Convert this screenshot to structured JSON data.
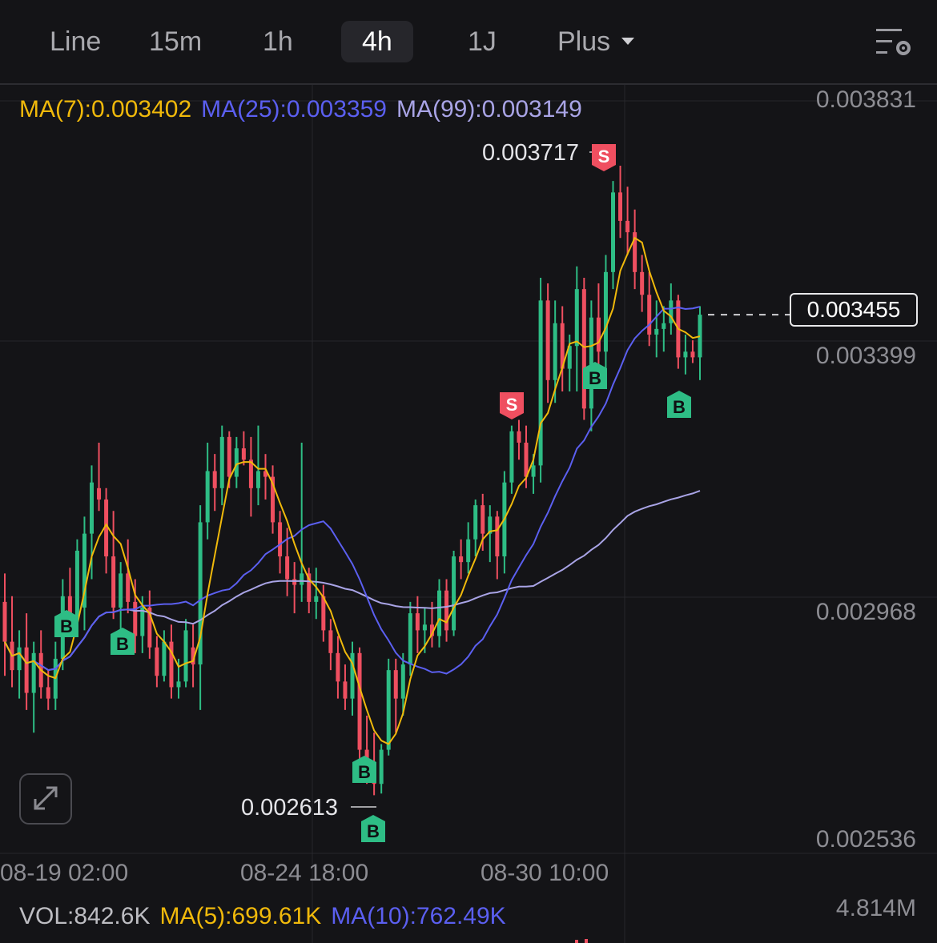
{
  "tabs": [
    {
      "label": "Line",
      "active": false
    },
    {
      "label": "15m",
      "active": false
    },
    {
      "label": "1h",
      "active": false
    },
    {
      "label": "4h",
      "active": true
    },
    {
      "label": "1J",
      "active": false
    },
    {
      "label": "Plus",
      "active": false,
      "dropdown": true
    }
  ],
  "toolbar": {
    "settings_icon": "chart-settings-icon"
  },
  "ma_legend": {
    "ma7": "MA(7):0.003402",
    "ma25": "MA(25):0.003359",
    "ma99": "MA(99):0.003149"
  },
  "colors": {
    "up": "#2ebd85",
    "down": "#ef4f60",
    "ma7": "#f0b90b",
    "ma25": "#5b5ff0",
    "ma99": "#a9a4e6",
    "grid": "#26262b"
  },
  "price_axis": [
    "0.003831",
    "0.003399",
    "0.002968",
    "0.002536"
  ],
  "current_price": "0.003455",
  "high_label": "0.003717",
  "low_label": "0.002613",
  "time_axis": [
    "08-19 02:00",
    "08-24 18:00",
    "08-30 10:00"
  ],
  "volume": {
    "vol": "VOL:842.6K",
    "ma5": "MA(5):699.61K",
    "ma10": "MA(10):762.49K",
    "max": "4.814M"
  },
  "markers": {
    "buy": "B",
    "sell": "S"
  },
  "chart_data": {
    "type": "candlestick",
    "interval": "4h",
    "ylim": [
      0.002536,
      0.003831
    ],
    "x_ticks": [
      "08-19 02:00",
      "08-24 18:00",
      "08-30 10:00"
    ],
    "candles": [
      [
        0.00295,
        0.003,
        0.00282,
        0.00288
      ],
      [
        0.00288,
        0.00296,
        0.0028,
        0.00283
      ],
      [
        0.00283,
        0.0029,
        0.00278,
        0.00287
      ],
      [
        0.00287,
        0.00293,
        0.00276,
        0.00279
      ],
      [
        0.00279,
        0.00288,
        0.00272,
        0.00286
      ],
      [
        0.00286,
        0.0029,
        0.00278,
        0.0028
      ],
      [
        0.0028,
        0.00283,
        0.00276,
        0.00278
      ],
      [
        0.00278,
        0.00288,
        0.00276,
        0.00285
      ],
      [
        0.00285,
        0.00299,
        0.00283,
        0.00296
      ],
      [
        0.00296,
        0.00301,
        0.00289,
        0.00292
      ],
      [
        0.00292,
        0.00306,
        0.00291,
        0.00304
      ],
      [
        0.00294,
        0.0031,
        0.0029,
        0.00307
      ],
      [
        0.00307,
        0.00319,
        0.00299,
        0.00316
      ],
      [
        0.00315,
        0.00323,
        0.00311,
        0.00313
      ],
      [
        0.00313,
        0.00315,
        0.003,
        0.00303
      ],
      [
        0.00303,
        0.00311,
        0.00292,
        0.00294
      ],
      [
        0.00294,
        0.00302,
        0.0029,
        0.003
      ],
      [
        0.003,
        0.00306,
        0.00293,
        0.00295
      ],
      [
        0.00295,
        0.00299,
        0.00286,
        0.00289
      ],
      [
        0.00289,
        0.00296,
        0.00286,
        0.00294
      ],
      [
        0.00294,
        0.00297,
        0.00285,
        0.00287
      ],
      [
        0.00287,
        0.00289,
        0.0028,
        0.00282
      ],
      [
        0.00282,
        0.0029,
        0.00281,
        0.00288
      ],
      [
        0.00288,
        0.00291,
        0.00278,
        0.0028
      ],
      [
        0.0028,
        0.00285,
        0.00278,
        0.00281
      ],
      [
        0.00281,
        0.00292,
        0.0028,
        0.0029
      ],
      [
        0.00287,
        0.00291,
        0.0028,
        0.00284
      ],
      [
        0.00284,
        0.00312,
        0.00276,
        0.00309
      ],
      [
        0.00309,
        0.00323,
        0.00306,
        0.00318
      ],
      [
        0.00318,
        0.00321,
        0.00311,
        0.00315
      ],
      [
        0.00315,
        0.00326,
        0.00312,
        0.00324
      ],
      [
        0.00324,
        0.00325,
        0.00315,
        0.00317
      ],
      [
        0.00317,
        0.00324,
        0.00315,
        0.00322
      ],
      [
        0.00322,
        0.00325,
        0.00319,
        0.0032
      ],
      [
        0.0032,
        0.00324,
        0.0031,
        0.00315
      ],
      [
        0.00315,
        0.00326,
        0.00312,
        0.00318
      ],
      [
        0.00318,
        0.00321,
        0.00313,
        0.00317
      ],
      [
        0.00317,
        0.00319,
        0.00307,
        0.00309
      ],
      [
        0.00309,
        0.00311,
        0.003,
        0.00303
      ],
      [
        0.00303,
        0.00308,
        0.00296,
        0.00299
      ],
      [
        0.00299,
        0.00302,
        0.00293,
        0.00298
      ],
      [
        0.00298,
        0.00323,
        0.00295,
        0.003
      ],
      [
        0.003,
        0.00301,
        0.00293,
        0.00295
      ],
      [
        0.00295,
        0.00301,
        0.00292,
        0.00296
      ],
      [
        0.00296,
        0.00298,
        0.00288,
        0.0029
      ],
      [
        0.0029,
        0.00292,
        0.00283,
        0.00286
      ],
      [
        0.00286,
        0.00289,
        0.00278,
        0.00281
      ],
      [
        0.00281,
        0.00284,
        0.00276,
        0.00278
      ],
      [
        0.00278,
        0.00288,
        0.00275,
        0.00286
      ],
      [
        0.00286,
        0.00287,
        0.00264,
        0.00269
      ],
      [
        0.00269,
        0.00275,
        0.00263,
        0.00266
      ],
      [
        0.00266,
        0.00272,
        0.00261,
        0.00263
      ],
      [
        0.00263,
        0.0027,
        0.002613,
        0.00269
      ],
      [
        0.00269,
        0.00285,
        0.00268,
        0.00283
      ],
      [
        0.00283,
        0.00285,
        0.00272,
        0.00278
      ],
      [
        0.00278,
        0.00286,
        0.00275,
        0.00284
      ],
      [
        0.00284,
        0.00295,
        0.00282,
        0.00293
      ],
      [
        0.00293,
        0.00296,
        0.00286,
        0.0029
      ],
      [
        0.0029,
        0.00294,
        0.00286,
        0.00291
      ],
      [
        0.00291,
        0.00295,
        0.00287,
        0.00289
      ],
      [
        0.00289,
        0.00299,
        0.00287,
        0.00297
      ],
      [
        0.00297,
        0.00299,
        0.00288,
        0.0029
      ],
      [
        0.0029,
        0.00304,
        0.00289,
        0.00303
      ],
      [
        0.00303,
        0.00306,
        0.00299,
        0.00302
      ],
      [
        0.00302,
        0.00309,
        0.003,
        0.00306
      ],
      [
        0.00306,
        0.00313,
        0.00303,
        0.00312
      ],
      [
        0.00312,
        0.00314,
        0.00304,
        0.00307
      ],
      [
        0.00307,
        0.00312,
        0.00302,
        0.0031
      ],
      [
        0.0031,
        0.00311,
        0.00299,
        0.00303
      ],
      [
        0.00303,
        0.00318,
        0.003,
        0.00316
      ],
      [
        0.00316,
        0.00326,
        0.00314,
        0.00325
      ],
      [
        0.00325,
        0.00327,
        0.0032,
        0.00323
      ],
      [
        0.00323,
        0.00326,
        0.00315,
        0.00317
      ],
      [
        0.00317,
        0.00321,
        0.00314,
        0.00319
      ],
      [
        0.00319,
        0.00352,
        0.00316,
        0.00348
      ],
      [
        0.00348,
        0.00351,
        0.0033,
        0.00334
      ],
      [
        0.00334,
        0.00348,
        0.0033,
        0.00344
      ],
      [
        0.00344,
        0.00347,
        0.00332,
        0.00336
      ],
      [
        0.00336,
        0.00342,
        0.00332,
        0.0034
      ],
      [
        0.0034,
        0.00354,
        0.00332,
        0.0035
      ],
      [
        0.0035,
        0.00352,
        0.00327,
        0.00329
      ],
      [
        0.00329,
        0.00348,
        0.00325,
        0.00345
      ],
      [
        0.00345,
        0.00351,
        0.00333,
        0.00339
      ],
      [
        0.00339,
        0.00356,
        0.00336,
        0.00353
      ],
      [
        0.00353,
        0.00369,
        0.0035,
        0.00367
      ],
      [
        0.00367,
        0.003717,
        0.00359,
        0.00362
      ],
      [
        0.00362,
        0.00368,
        0.00356,
        0.0036
      ],
      [
        0.0036,
        0.00364,
        0.0035,
        0.00353
      ],
      [
        0.00353,
        0.00356,
        0.00346,
        0.00349
      ],
      [
        0.00349,
        0.00353,
        0.0034,
        0.00342
      ],
      [
        0.00342,
        0.00348,
        0.00338,
        0.00343
      ],
      [
        0.00343,
        0.00347,
        0.00339,
        0.00344
      ],
      [
        0.00344,
        0.00351,
        0.00342,
        0.00348
      ],
      [
        0.00348,
        0.00349,
        0.00336,
        0.00338
      ],
      [
        0.00338,
        0.00342,
        0.00335,
        0.00339
      ],
      [
        0.00339,
        0.00341,
        0.00337,
        0.00338
      ],
      [
        0.00338,
        0.00347,
        0.00334,
        0.003455
      ]
    ]
  }
}
